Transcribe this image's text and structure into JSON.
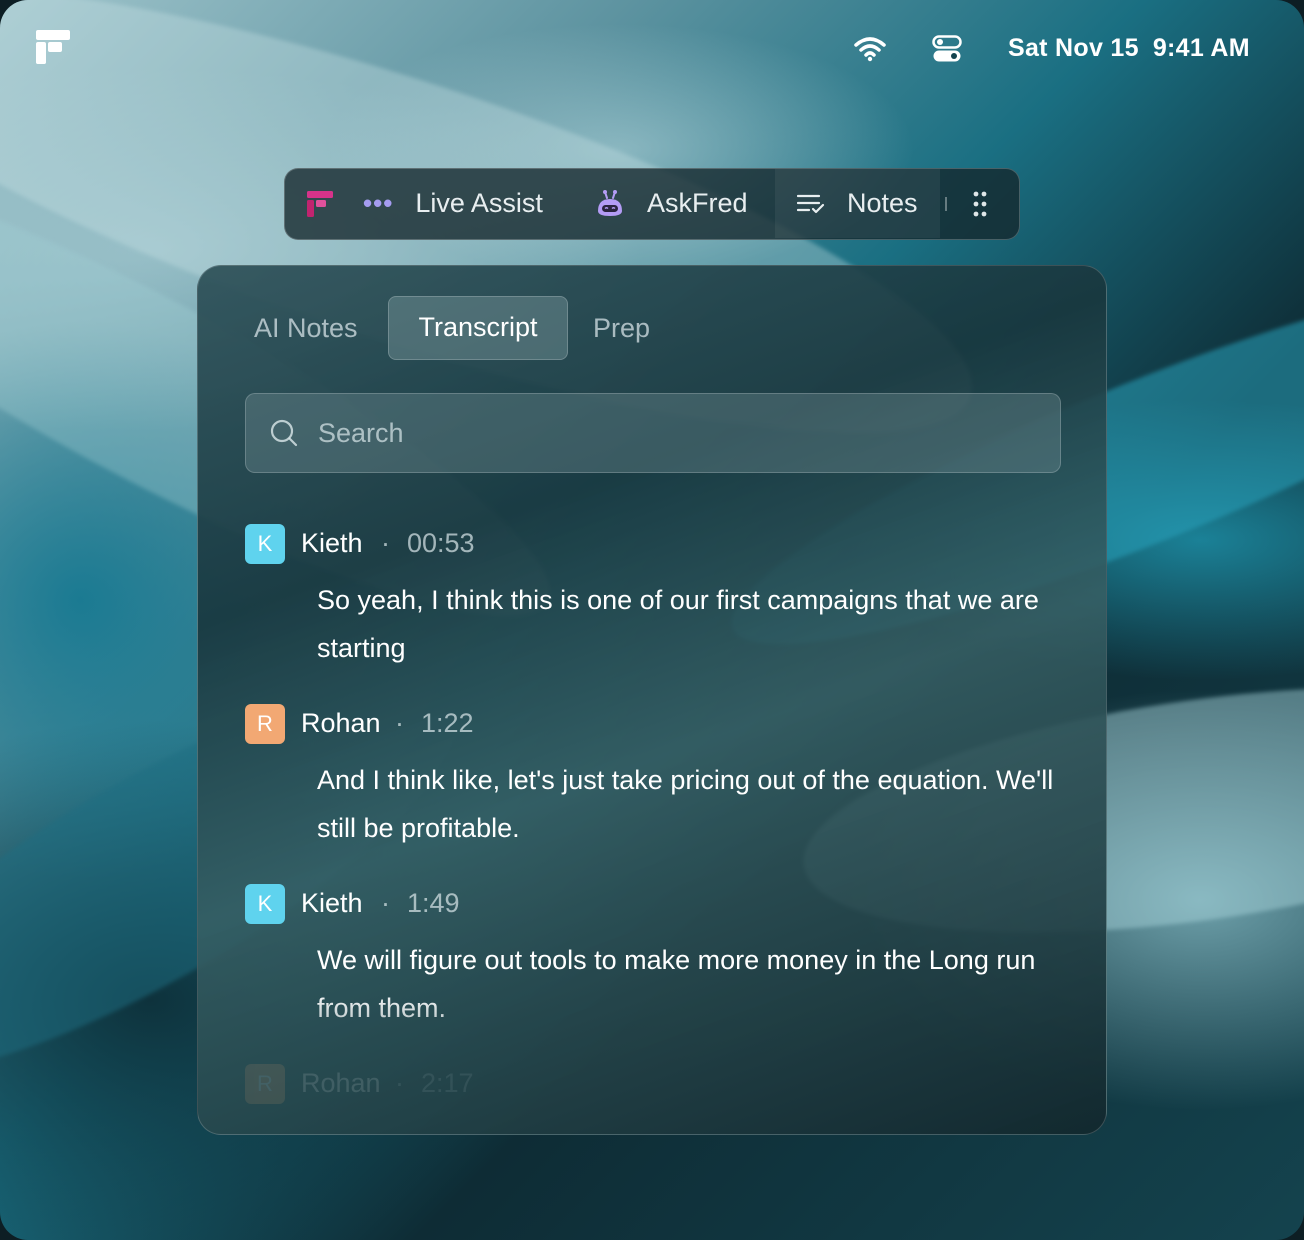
{
  "menubar": {
    "date": "Sat Nov 15",
    "time": "9:41 AM"
  },
  "toolbar": {
    "live_assist_label": "Live Assist",
    "askfred_label": "AskFred",
    "notes_label": "Notes"
  },
  "tabs": [
    {
      "label": "AI Notes",
      "active": false
    },
    {
      "label": "Transcript",
      "active": true
    },
    {
      "label": "Prep",
      "active": false
    }
  ],
  "search": {
    "placeholder": "Search"
  },
  "transcript": [
    {
      "initial": "K",
      "speaker": "Kieth",
      "time": "00:53",
      "text": "So yeah, I think this is one of our first campaigns that we are starting",
      "color": "#5fd3ee"
    },
    {
      "initial": "R",
      "speaker": "Rohan",
      "time": "1:22",
      "text": "And I think like, let's just take pricing out of the equation. We'll still be profitable.",
      "color": "#f2a873"
    },
    {
      "initial": "K",
      "speaker": "Kieth",
      "time": "1:49",
      "text": "We will figure out tools to make more money in the Long run from them.",
      "color": "#5fd3ee"
    },
    {
      "initial": "R",
      "speaker": "Rohan",
      "time": "2:17",
      "text": "",
      "color": "#f2a873"
    }
  ],
  "colors": {
    "askfred_icon": "#b49cf5",
    "live_dots": "#a59cf0",
    "logo_accent": "#d6338a"
  }
}
